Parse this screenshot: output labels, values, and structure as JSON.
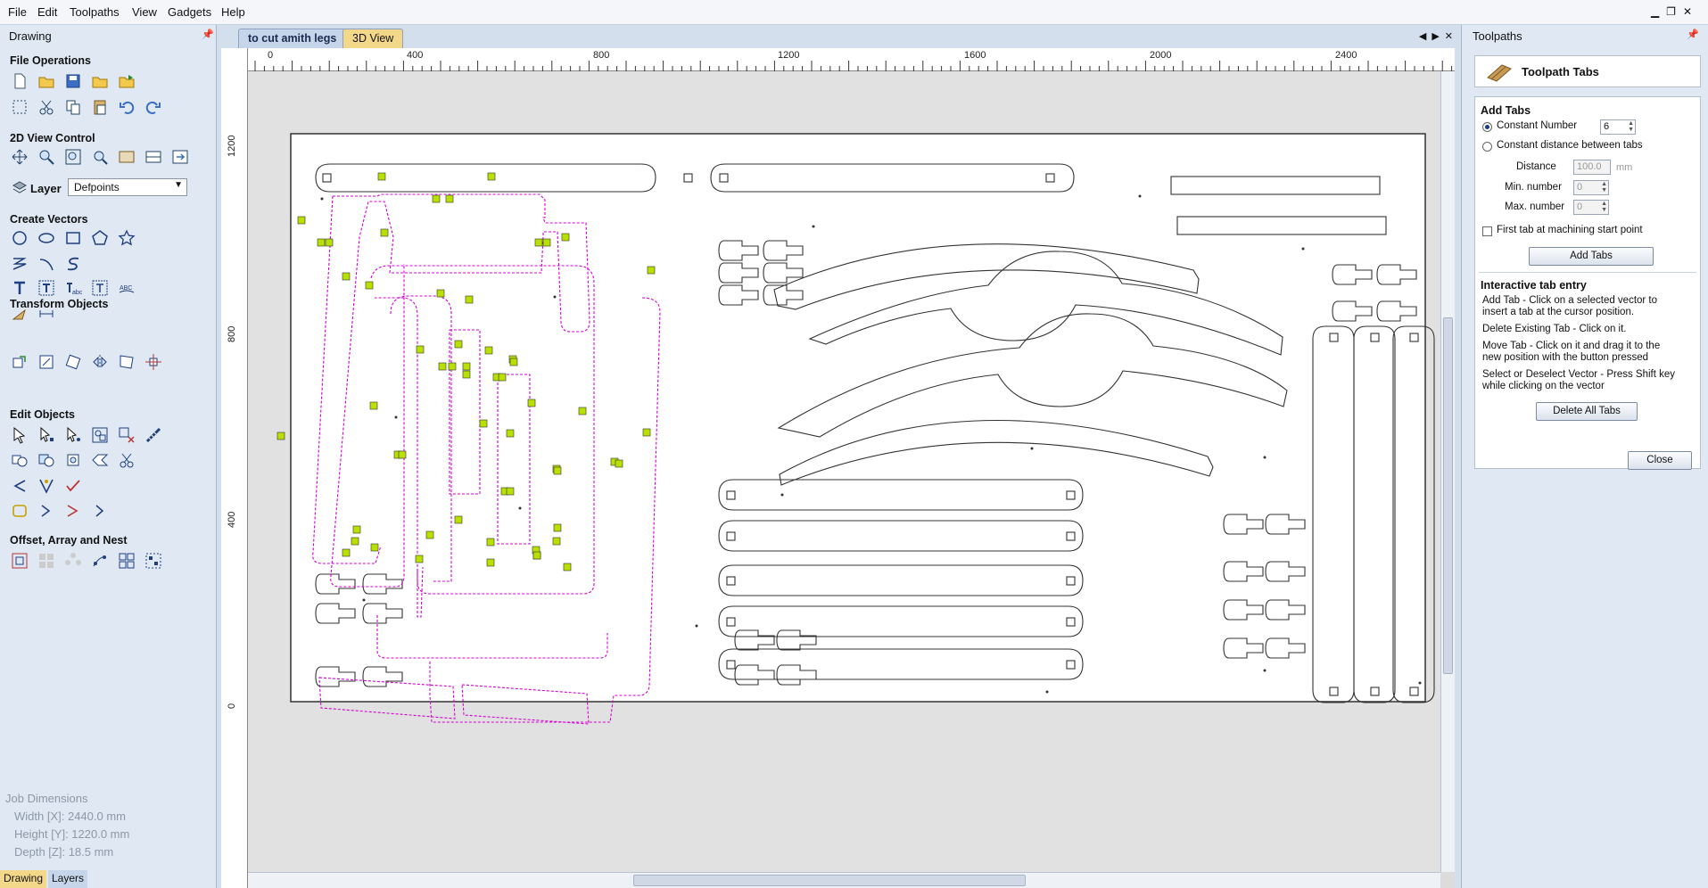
{
  "menu": [
    "File",
    "Edit",
    "Toolpaths",
    "View",
    "Gadgets",
    "Help"
  ],
  "left_panel": {
    "title": "Drawing",
    "sections": {
      "file_operations": "File Operations",
      "view_control": "2D View Control",
      "create_vectors": "Create Vectors",
      "transform_objects": "Transform Objects",
      "edit_objects": "Edit Objects",
      "offset_array": "Offset, Array and Nest"
    },
    "layer_label": "Layer",
    "layer_value": "Defpoints",
    "job_dimensions": {
      "title": "Job Dimensions",
      "width": "Width  [X]: 2440.0 mm",
      "height": "Height [Y]: 1220.0 mm",
      "depth": "Depth  [Z]: 18.5 mm"
    },
    "bottom_tabs": [
      "Drawing",
      "Layers"
    ]
  },
  "document_tabs": [
    "to cut amith legs",
    "3D View"
  ],
  "ruler": {
    "x_ticks": [
      "0",
      "400",
      "800",
      "1200",
      "1600",
      "2000",
      "2400"
    ],
    "y_ticks": [
      "0",
      "400",
      "800",
      "1200"
    ]
  },
  "right_panel": {
    "title": "Toolpaths",
    "header": "Toolpath Tabs",
    "add_tabs_title": "Add Tabs",
    "constant_number_label": "Constant Number",
    "constant_number_value": "6",
    "constant_distance_label": "Constant distance between tabs",
    "distance_label": "Distance",
    "distance_value": "100.0",
    "distance_unit": "mm",
    "min_label": "Min. number",
    "min_value": "0",
    "max_label": "Max. number",
    "max_value": "0",
    "first_tab_label": "First tab at machining start point",
    "add_tabs_button": "Add Tabs",
    "interactive_title": "Interactive tab entry",
    "help_add_1": "Add Tab - Click on a selected vector to",
    "help_add_2": "insert a tab at the cursor position.",
    "help_delete": "Delete Existing Tab - Click on it.",
    "help_move_1": "Move Tab - Click on it and drag it to the",
    "help_move_2": "new position with the button pressed",
    "help_select_1": "Select or Deselect Vector - Press Shift key",
    "help_select_2": "while clicking on the vector",
    "delete_all_button": "Delete All Tabs",
    "close_button": "Close"
  },
  "colors": {
    "selected_vector": "#d400d4",
    "tab_marker": "#b8e000",
    "accent_tab": "#f4d88a"
  }
}
